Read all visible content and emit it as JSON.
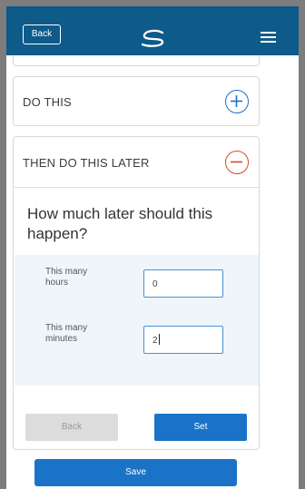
{
  "header": {
    "back_label": "Back",
    "logo_icon": "s-swirl-logo",
    "menu_icon": "hamburger-menu-icon",
    "bg_color": "#0e5a8a"
  },
  "sections": {
    "do_this": {
      "title": "DO THIS",
      "icon": "plus-circle-icon",
      "icon_color": "#1a73c7"
    },
    "then_do_later": {
      "title": "THEN DO THIS LATER",
      "icon": "minus-circle-icon",
      "icon_color": "#e0442c"
    }
  },
  "form": {
    "question": "How much later should this happen?",
    "hours": {
      "label": "This many hours",
      "value": "0"
    },
    "minutes": {
      "label": "This many minutes",
      "value": "2"
    },
    "back_label": "Back",
    "set_label": "Set"
  },
  "footer": {
    "save_label": "Save"
  },
  "colors": {
    "primary": "#1a73c7",
    "danger": "#e0442c",
    "panel": "#eef5fb",
    "disabled": "#dcdcdc"
  }
}
